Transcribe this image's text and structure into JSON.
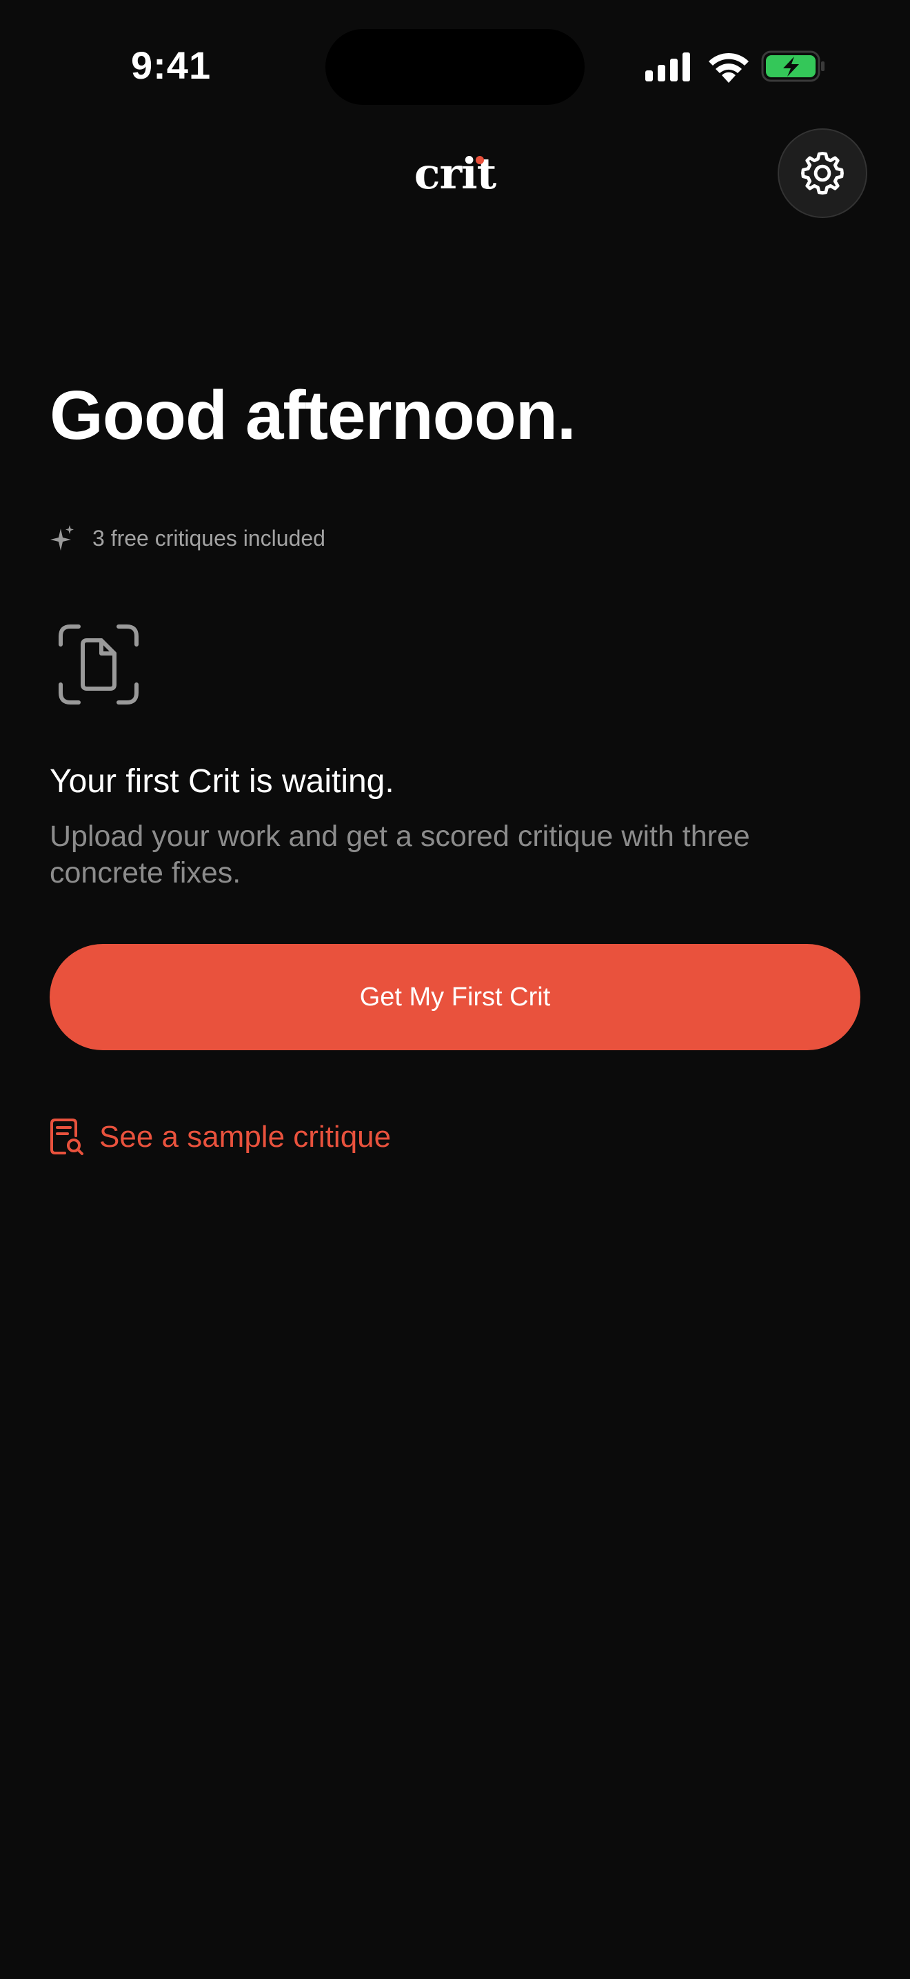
{
  "status_bar": {
    "time": "9:41"
  },
  "header": {
    "logo": "crit",
    "settings_icon": "gear-icon"
  },
  "main": {
    "greeting": "Good afternoon.",
    "free_critiques": "3 free critiques included",
    "empty_state": {
      "icon": "document-scan-icon",
      "title": "Your first Crit is waiting.",
      "subtitle": "Upload your work and get a scored critique with three concrete fixes."
    },
    "cta_label": "Get My First Crit",
    "sample_link": "See a sample critique"
  },
  "colors": {
    "background": "#0b0b0b",
    "accent": "#e9523d",
    "battery_green": "#34c759"
  }
}
